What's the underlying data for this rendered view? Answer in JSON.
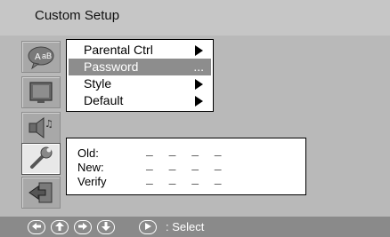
{
  "header": {
    "title": "Custom Setup"
  },
  "sidebar": {
    "icons": [
      {
        "name": "language-speech-icon"
      },
      {
        "name": "screen-display-icon"
      },
      {
        "name": "audio-speaker-icon"
      },
      {
        "name": "wrench-tools-icon",
        "selected": true
      },
      {
        "name": "exit-return-icon"
      }
    ]
  },
  "menu": {
    "items": [
      {
        "label": "Parental Ctrl",
        "indicator": "arrow",
        "active": false
      },
      {
        "label": "Password",
        "indicator": "...",
        "active": true
      },
      {
        "label": "Style",
        "indicator": "arrow",
        "active": false
      },
      {
        "label": "Default",
        "indicator": "arrow",
        "active": false
      }
    ]
  },
  "password": {
    "rows": [
      {
        "label": "Old:",
        "value": "_ _ _ _"
      },
      {
        "label": "New:",
        "value": "_ _ _ _"
      },
      {
        "label": "Verify",
        "value": "_ _ _ _"
      }
    ]
  },
  "footer": {
    "keys": [
      "left-arrow-icon",
      "up-arrow-icon",
      "right-arrow-icon",
      "down-arrow-icon",
      "play-icon"
    ],
    "hint": ": Select"
  },
  "colors": {
    "background": "#b9b9b9",
    "header": "#c6c6c6",
    "highlight": "#8d8d8d",
    "footer": "#8a8a8a"
  }
}
